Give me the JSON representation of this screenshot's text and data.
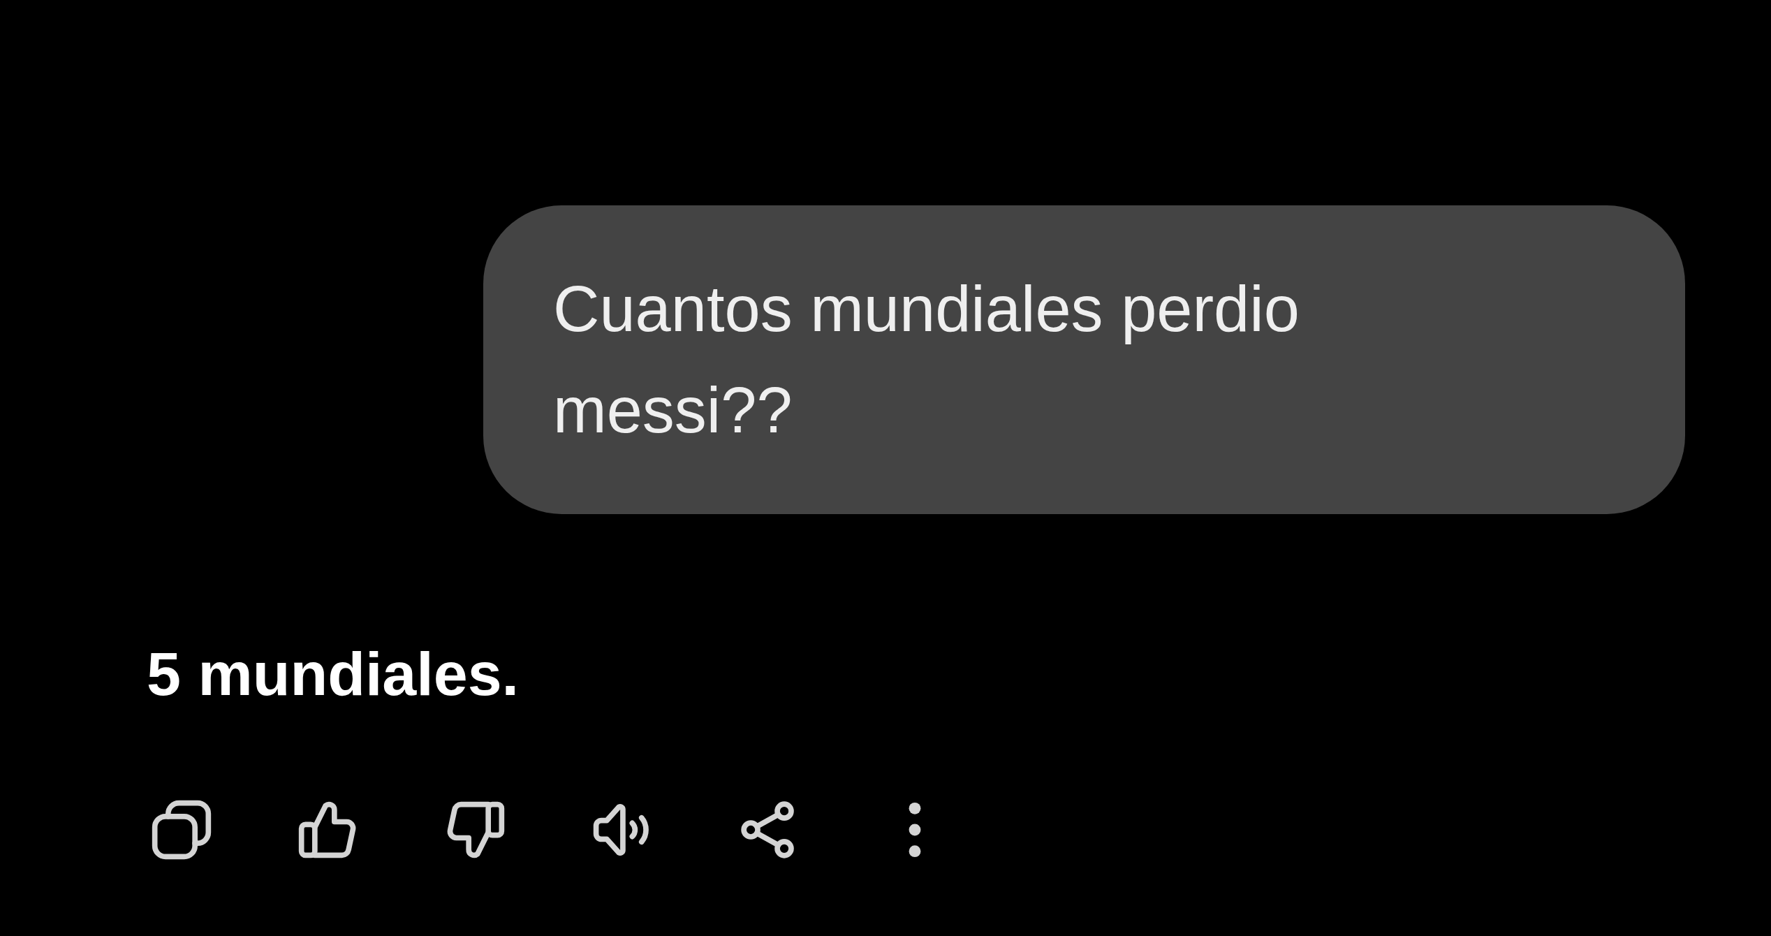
{
  "conversation": {
    "messages": [
      {
        "kind": "user",
        "text": "Cuantos mundiales perdio messi??"
      },
      {
        "kind": "assistant",
        "text": "5 mundiales."
      }
    ]
  }
}
